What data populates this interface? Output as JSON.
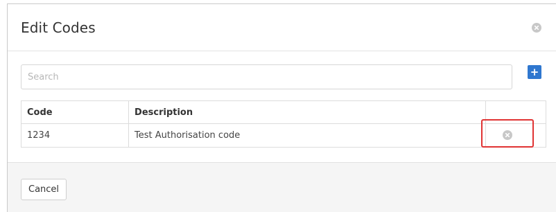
{
  "dialog": {
    "title": "Edit Codes"
  },
  "search": {
    "placeholder": "Search",
    "value": ""
  },
  "table": {
    "columns": [
      "Code",
      "Description",
      ""
    ],
    "rows": [
      {
        "code": "1234",
        "description": "Test Authorisation code"
      }
    ]
  },
  "footer": {
    "cancel_label": "Cancel"
  },
  "icons": {
    "header_close": "close-circle-icon",
    "add": "plus-icon",
    "row_remove": "close-circle-icon"
  },
  "colors": {
    "accent": "#2f77cf",
    "highlight": "#e03333",
    "icon_gray": "#c8c8c8",
    "footer_bg": "#f5f5f5"
  }
}
